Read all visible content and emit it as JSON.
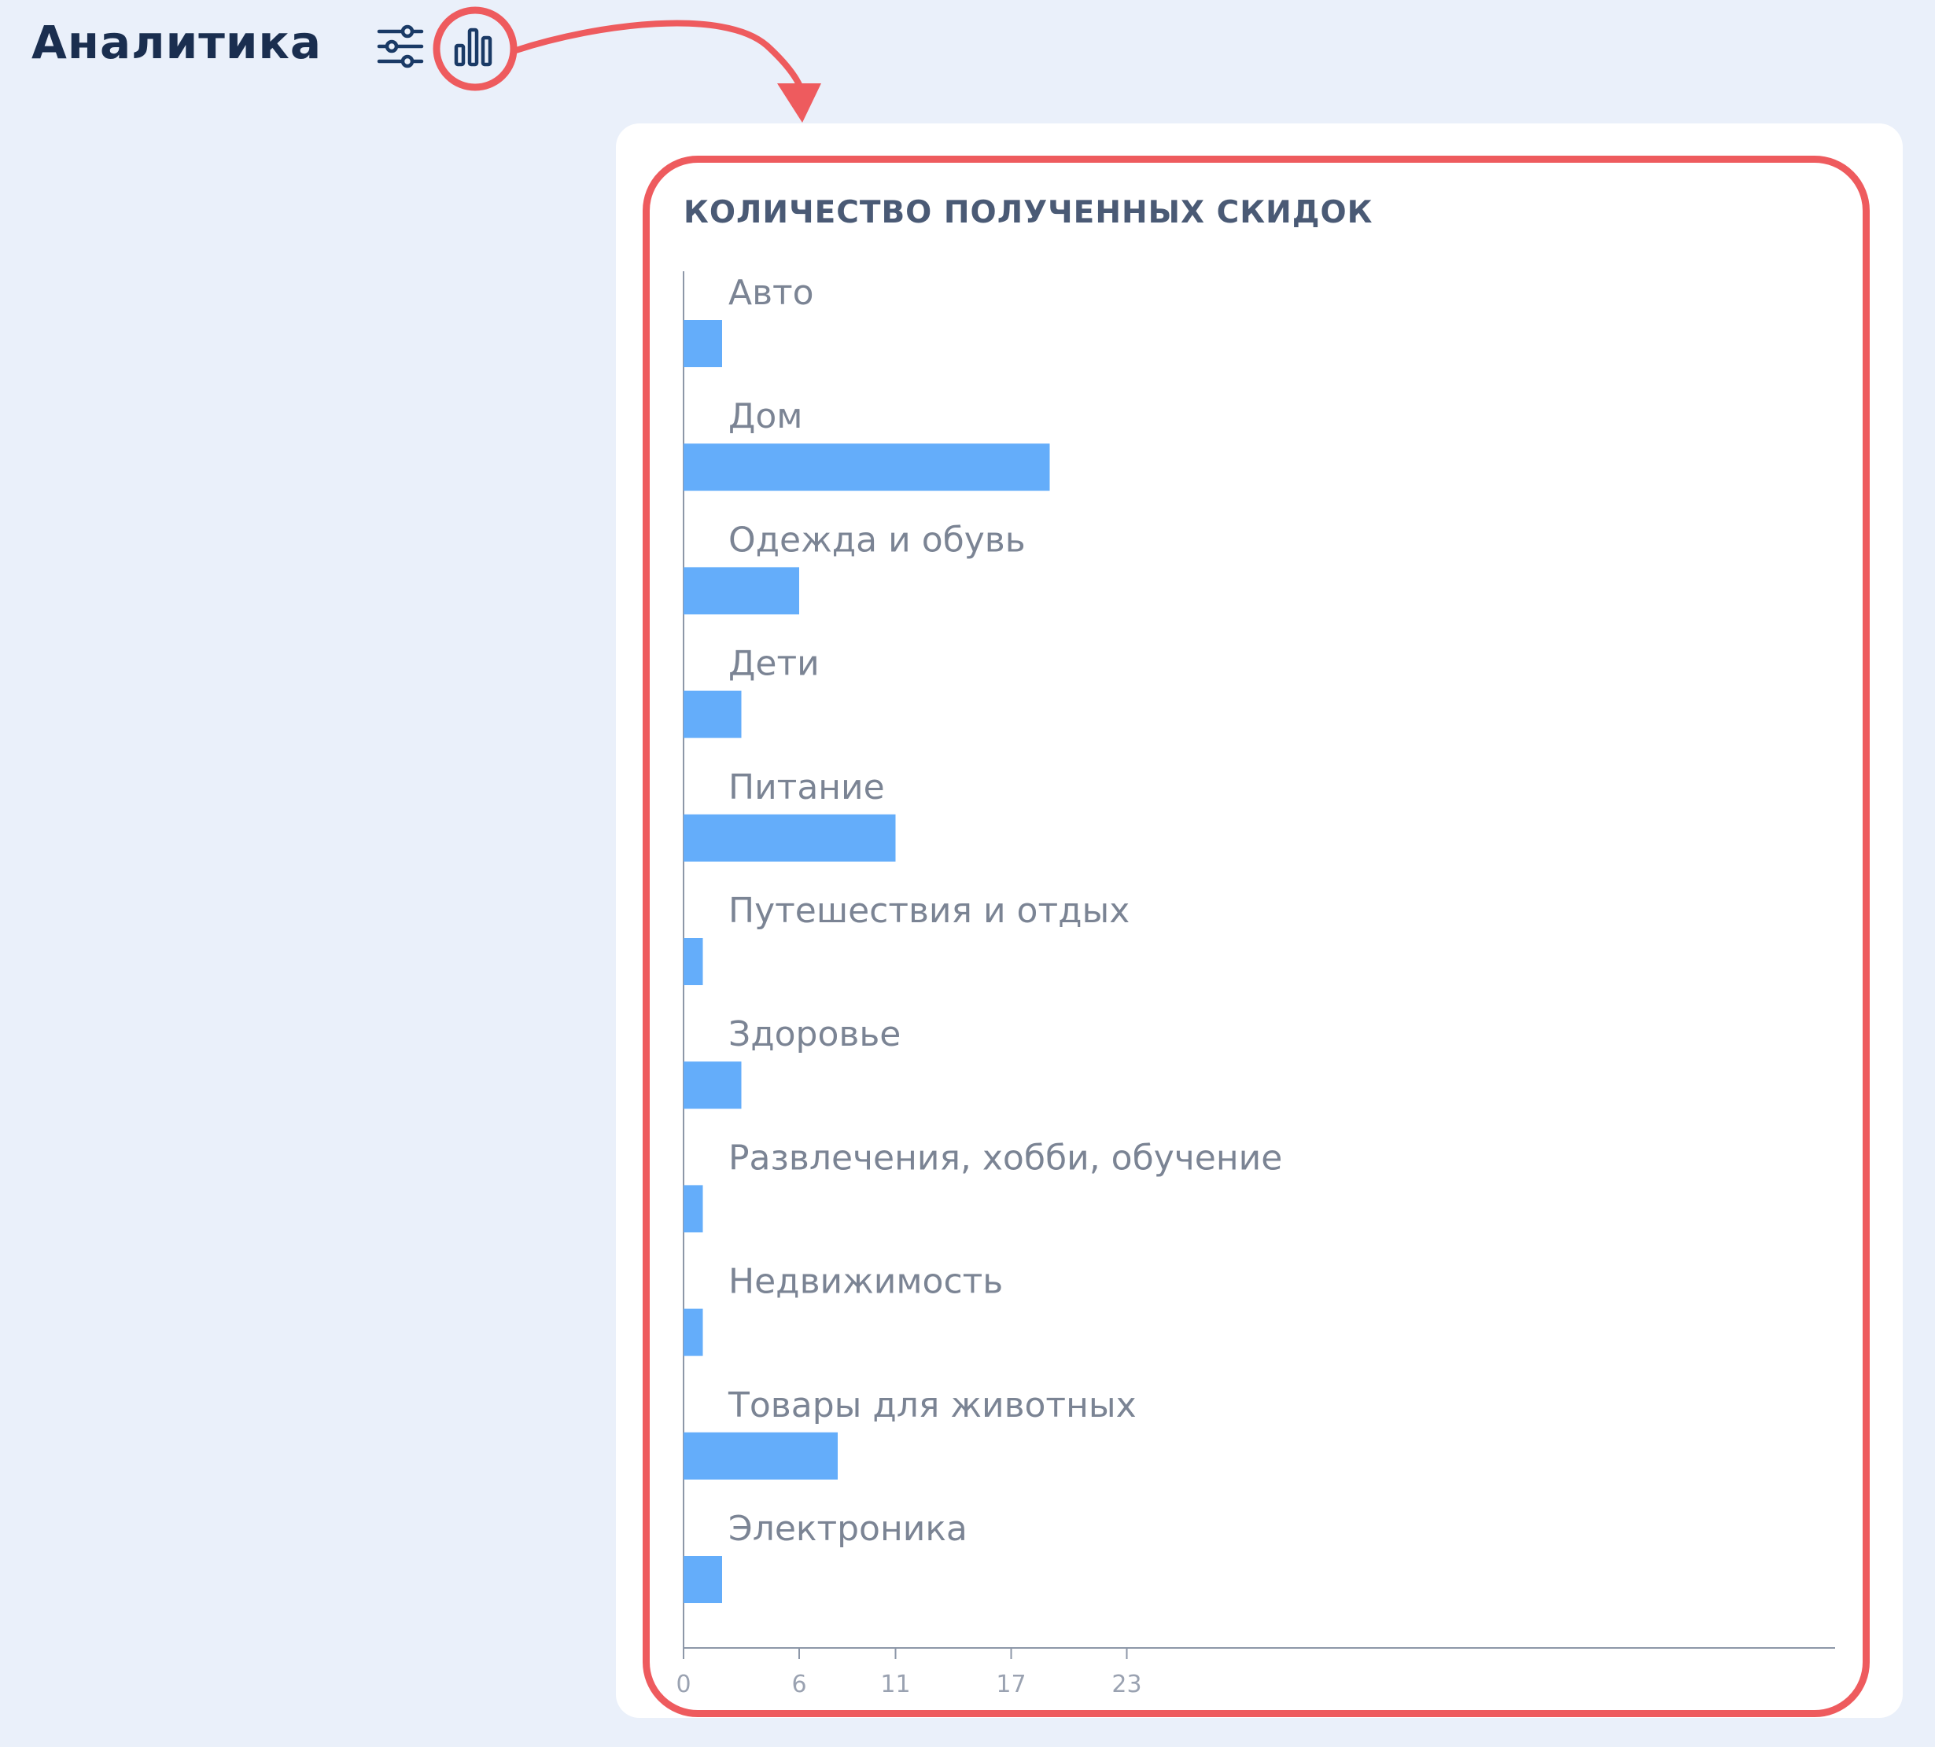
{
  "header": {
    "title": "Аналитика",
    "filter_icon": "sliders-icon",
    "chart_icon": "bar-chart-icon"
  },
  "colors": {
    "accent_bar": "#64adfa",
    "highlight": "#ee5b5e",
    "title": "#1a2e4f",
    "background": "#eaf0fa"
  },
  "chart_data": {
    "type": "bar",
    "orientation": "horizontal",
    "title": "КОЛИЧЕСТВО ПОЛУЧЕННЫХ СКИДОК",
    "categories": [
      "Авто",
      "Дом",
      "Одежда и обувь",
      "Дети",
      "Питание",
      "Путешествия и отдых",
      "Здоровье",
      "Развлечения, хобби, обучение",
      "Недвижимость",
      "Товары для животных",
      "Электроника"
    ],
    "values": [
      2,
      19,
      6,
      3,
      11,
      1,
      3,
      1,
      1,
      8,
      2
    ],
    "xticks": [
      "0",
      "6",
      "11",
      "17",
      "23"
    ],
    "xtick_values": [
      0,
      6,
      11,
      17,
      23
    ],
    "xlim": [
      0,
      23
    ],
    "grid": false,
    "legend": "none"
  }
}
